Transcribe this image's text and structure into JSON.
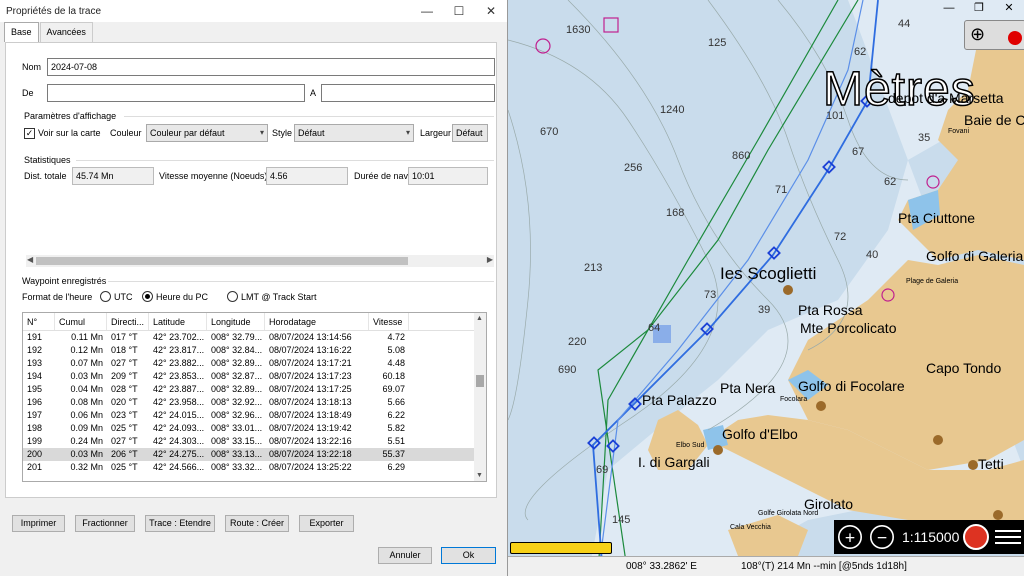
{
  "dialog": {
    "title": "Propriétés de la trace",
    "tabs": [
      {
        "label": "Base"
      },
      {
        "label": "Avancées"
      }
    ],
    "name_label": "Nom",
    "name_value": "2024-07-08",
    "from_label": "De",
    "from_value": "",
    "to_label": "A",
    "to_value": "",
    "display_group": "Paramètres d'affichage",
    "show_on_map": "Voir sur la carte",
    "color_label": "Couleur",
    "color_value": "Couleur par défaut",
    "style_label": "Style",
    "style_value": "Défaut",
    "width_label": "Largeur",
    "width_value": "Défaut",
    "stats_group": "Statistiques",
    "dist_label": "Dist. totale",
    "dist_value": "45.74 Mn",
    "speed_label": "Vitesse moyenne (Noeuds)",
    "speed_value": "4.56",
    "duration_label": "Durée de nav.",
    "duration_value": "10:01",
    "waypoints_group": "Waypoint enregistrés",
    "time_format_label": "Format de l'heure",
    "radio_utc": "UTC",
    "radio_pc": "Heure du PC",
    "radio_lmt": "LMT @ Track Start",
    "table": {
      "headers": [
        "N°",
        "Cumul",
        "Directi...",
        "Latitude",
        "Longitude",
        "Horodatage",
        "Vitesse"
      ],
      "rows": [
        [
          "191",
          "0.11 Mn",
          "017 °T",
          "42° 23.702...",
          "008° 32.79...",
          "08/07/2024 13:14:56",
          "4.72"
        ],
        [
          "192",
          "0.12 Mn",
          "018 °T",
          "42° 23.817...",
          "008° 32.84...",
          "08/07/2024 13:16:22",
          "5.08"
        ],
        [
          "193",
          "0.07 Mn",
          "027 °T",
          "42° 23.882...",
          "008° 32.89...",
          "08/07/2024 13:17:21",
          "4.48"
        ],
        [
          "194",
          "0.03 Mn",
          "209 °T",
          "42° 23.853...",
          "008° 32.87...",
          "08/07/2024 13:17:23",
          "60.18"
        ],
        [
          "195",
          "0.04 Mn",
          "028 °T",
          "42° 23.887...",
          "008° 32.89...",
          "08/07/2024 13:17:25",
          "69.07"
        ],
        [
          "196",
          "0.08 Mn",
          "020 °T",
          "42° 23.958...",
          "008° 32.92...",
          "08/07/2024 13:18:13",
          "5.66"
        ],
        [
          "197",
          "0.06 Mn",
          "023 °T",
          "42° 24.015...",
          "008° 32.96...",
          "08/07/2024 13:18:49",
          "6.22"
        ],
        [
          "198",
          "0.09 Mn",
          "025 °T",
          "42° 24.093...",
          "008° 33.01...",
          "08/07/2024 13:19:42",
          "5.82"
        ],
        [
          "199",
          "0.24 Mn",
          "027 °T",
          "42° 24.303...",
          "008° 33.15...",
          "08/07/2024 13:22:16",
          "5.51"
        ],
        [
          "200",
          "0.03 Mn",
          "206 °T",
          "42° 24.275...",
          "008° 33.13...",
          "08/07/2024 13:22:18",
          "55.37"
        ],
        [
          "201",
          "0.32 Mn",
          "025 °T",
          "42° 24.566...",
          "008° 33.32...",
          "08/07/2024 13:25:22",
          "6.29"
        ]
      ],
      "selected_index": 9
    },
    "buttons": {
      "print": "Imprimer",
      "split": "Fractionner",
      "extend": "Trace : Etendre",
      "create_route": "Route : Créer",
      "export": "Exporter",
      "cancel": "Annuler",
      "ok": "Ok"
    }
  },
  "map": {
    "overlay_text": "Mètres",
    "place_labels": [
      {
        "text": "Ies Scoglietti",
        "size": "huge"
      },
      {
        "text": "Pta Ciuttone",
        "size": "big"
      },
      {
        "text": "Golfo di Galeria",
        "size": "big"
      },
      {
        "text": "Plage de Galeria",
        "size": "small"
      },
      {
        "text": "Pta Rossa",
        "size": "big"
      },
      {
        "text": "Mte Porcolicato",
        "size": "big"
      },
      {
        "text": "Capo Tondo",
        "size": "big"
      },
      {
        "text": "Pta Nera",
        "size": "big"
      },
      {
        "text": "Golfo di Focolare",
        "size": "big"
      },
      {
        "text": "Focolara",
        "size": "small"
      },
      {
        "text": "Pta Palazzo",
        "size": "big"
      },
      {
        "text": "Golfo d'Elbo",
        "size": "big"
      },
      {
        "text": "Elbo Sud",
        "size": "small"
      },
      {
        "text": "I. di Gargali",
        "size": "big"
      },
      {
        "text": "Tetti",
        "size": "big"
      },
      {
        "text": "Girolato",
        "size": "big"
      },
      {
        "text": "Golfe Girolata Nord",
        "size": "small"
      },
      {
        "text": "Cala Vecchia",
        "size": "small"
      },
      {
        "text": "depot d'a Marsetta",
        "size": "big"
      },
      {
        "text": "Baie de C",
        "size": "big"
      },
      {
        "text": "Fovani",
        "size": "small"
      }
    ],
    "depths": [
      "1630",
      "125",
      "44",
      "62",
      "670",
      "1240",
      "101",
      "35",
      "860",
      "67",
      "256",
      "62",
      "71",
      "168",
      "72",
      "40",
      "213",
      "73",
      "39",
      "220",
      "690",
      "64",
      "69",
      "145"
    ],
    "scale": "1:115000",
    "status": {
      "longitude": "008° 33.2862' E",
      "heading": "108°(T)  214 Mn --min [@5nds 1d18h]"
    },
    "progress": 1.0
  }
}
